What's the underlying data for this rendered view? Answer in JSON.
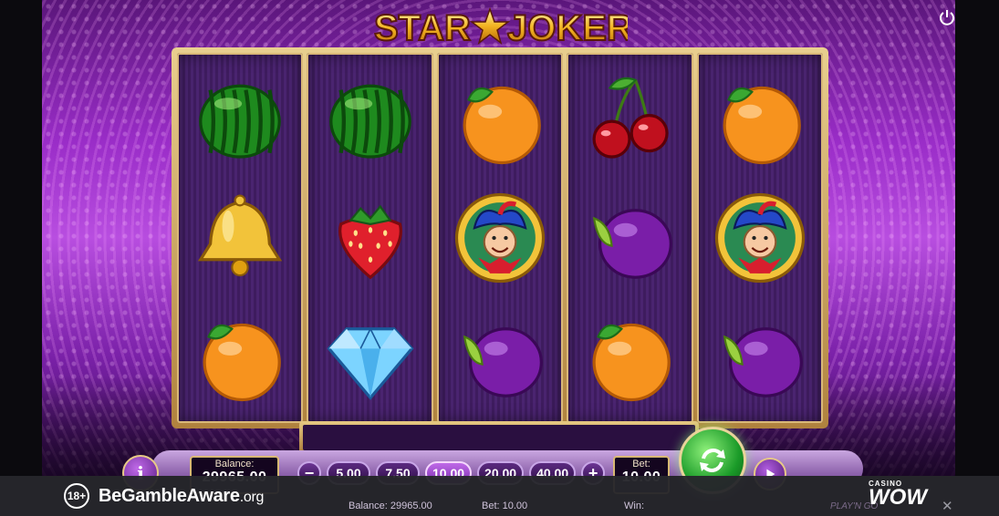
{
  "game": {
    "title_left": "STAR",
    "title_right": "JOKER",
    "reels": [
      [
        "watermelon",
        "bell",
        "orange"
      ],
      [
        "watermelon",
        "strawberry",
        "diamond"
      ],
      [
        "orange",
        "joker",
        "plum"
      ],
      [
        "cherries",
        "plum",
        "orange"
      ],
      [
        "orange",
        "joker",
        "plum"
      ]
    ]
  },
  "controls": {
    "info_label": "i",
    "balance_label": "Balance:",
    "balance_value": "29965.00",
    "minus_label": "−",
    "plus_label": "+",
    "bet_options": [
      "5.00",
      "7.50",
      "10.00",
      "20.00",
      "40.00"
    ],
    "active_bet_index": 2,
    "bet_label": "Bet:",
    "bet_value": "10.00"
  },
  "ticker": {
    "balance": "Balance: 29965.00",
    "bet": "Bet: 10.00",
    "win": "Win:",
    "provider": "PLAY'N GO"
  },
  "banner": {
    "age": "18+",
    "bga_main": "BeGambleAware",
    "bga_org": ".org",
    "casino_label": "CASINO",
    "wow_label": "WOW",
    "close_label": "✕"
  },
  "colors": {
    "accent_gold": "#e6c882",
    "purple": "#9a2dc8",
    "spin_green": "#1a9a28"
  }
}
